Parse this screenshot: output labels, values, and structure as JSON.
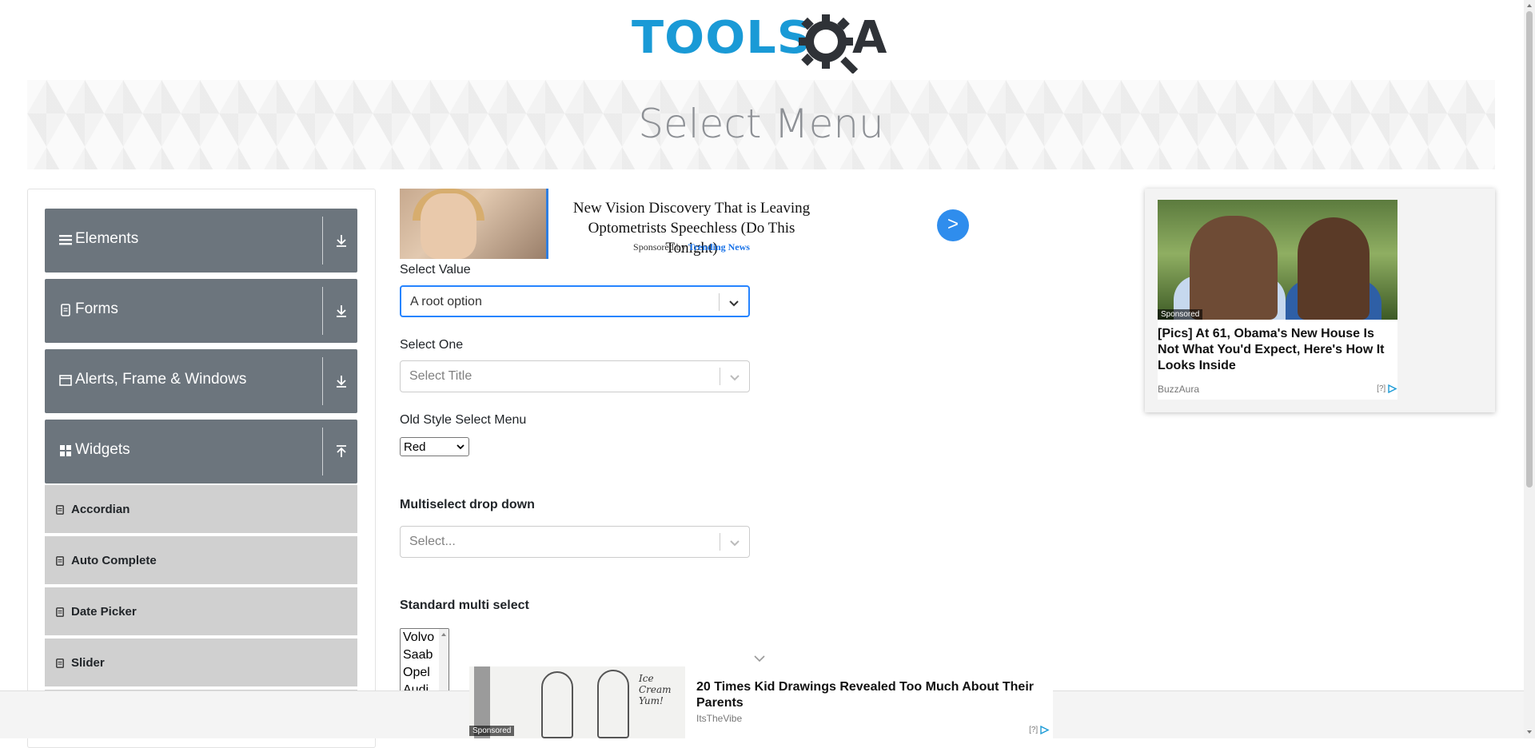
{
  "header": {
    "logo_text": "TOOLS",
    "logo_letter": "A"
  },
  "banner": {
    "title": "Select Menu"
  },
  "sidebar": {
    "groups": [
      {
        "label": "Elements",
        "icon": "hamburger-icon",
        "state": "collapsed"
      },
      {
        "label": "Forms",
        "icon": "document-icon",
        "state": "collapsed"
      },
      {
        "label": "Alerts, Frame & Windows",
        "icon": "window-icon",
        "state": "collapsed"
      },
      {
        "label": "Widgets",
        "icon": "widgets-icon",
        "state": "expanded"
      }
    ],
    "items": [
      {
        "label": "Accordian"
      },
      {
        "label": "Auto Complete"
      },
      {
        "label": "Date Picker"
      },
      {
        "label": "Slider"
      }
    ]
  },
  "ad_top": {
    "headline": "New Vision Discovery That is Leaving Optometrists Speechless (Do This Tonight)",
    "sponsor_prefix": "Sponsored by",
    "sponsor_name": "Trending News",
    "go_label": ">"
  },
  "form": {
    "select_value": {
      "label": "Select Value",
      "value": "A root option"
    },
    "select_one": {
      "label": "Select One",
      "placeholder": "Select Title"
    },
    "old_style": {
      "label": "Old Style Select Menu",
      "value": "Red"
    },
    "multiselect": {
      "label": "Multiselect drop down",
      "placeholder": "Select..."
    },
    "standard_multi": {
      "label": "Standard multi select",
      "options": [
        "Volvo",
        "Saab",
        "Opel",
        "Audi"
      ]
    }
  },
  "ad_right": {
    "tag": "Sponsored",
    "title": "[Pics] At 61, Obama's New House Is Not What You'd Expect, Here's How It Looks Inside",
    "source": "BuzzAura",
    "info": "[?]"
  },
  "ad_bottom": {
    "tag": "Sponsored",
    "title": "20 Times Kid Drawings Revealed Too Much About Their Parents",
    "source": "ItsTheVibe",
    "info": "[?]",
    "scribble": "Ice Cream Yum!"
  },
  "colors": {
    "brand_blue": "#1a9ad6",
    "sidebar_group": "#6c757d",
    "sidebar_item": "#d0d0d0",
    "focus_border": "#2684ff"
  }
}
